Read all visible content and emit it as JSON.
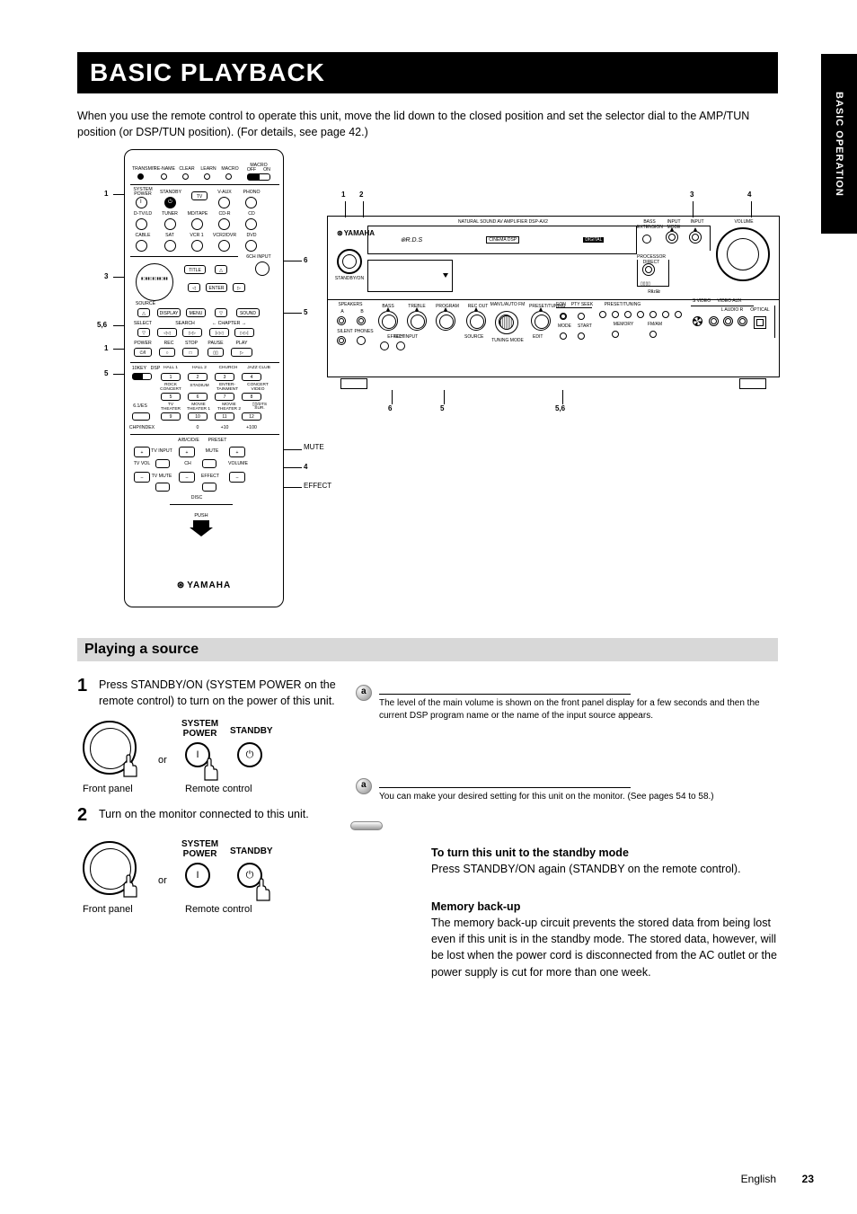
{
  "page": {
    "sidebar_tab": "BASIC OPERATION",
    "title": "BASIC PLAYBACK",
    "intro": "When you use the remote control to operate this unit, move the lid down to the closed position and set the selector dial to the AMP/TUN position (or DSP/TUN position). (For details, see page 42.)",
    "page_number": "23",
    "language": "English"
  },
  "remote": {
    "brand": "YAMAHA",
    "top_row": {
      "transmit": "TRANSMIT",
      "remame": "RE-NAME",
      "clear": "CLEAR",
      "learn": "LEARN",
      "macro": "MACRO",
      "macro_switch": [
        "OFF",
        "ON"
      ]
    },
    "row2": {
      "system_power": "SYSTEM POWER",
      "standby": "STANDBY",
      "tv": "TV",
      "vaux": "V-AUX",
      "phono": "PHONO"
    },
    "row3": {
      "dtvld": "D-TV/LD",
      "tuner": "TUNER",
      "mdtape": "MD/TAPE",
      "cdr": "CD-R",
      "cd": "CD"
    },
    "row4": {
      "cable": "CABLE",
      "sat": "SAT",
      "vcr1": "VCR 1",
      "vcr2dvr": "VCR2/DVR",
      "dvd": "DVD"
    },
    "sixch": "6CH INPUT",
    "dial_label": "",
    "nav": {
      "title": "TITLE",
      "enter": "ENTER",
      "chapter": "CHAPTER"
    },
    "source_row": {
      "source": "SOURCE",
      "display": "DISPLAY",
      "menu": "MENU",
      "sound": "SOUND"
    },
    "select_row": {
      "select": "SELECT",
      "search": "SEARCH"
    },
    "transport": {
      "power": "POWER",
      "rec": "REC",
      "stop": "STOP",
      "pause": "PAUSE",
      "play": "PLAY"
    },
    "tenkey": {
      "label": "10KEY",
      "dsp": "DSP"
    },
    "dsp_names": {
      "hall1": "HALL 1",
      "hall2": "HALL 2",
      "church": "CHURCH",
      "jazz": "JAZZ CLUB",
      "rock": "ROCK CONCERT",
      "stadium": "STADIUM",
      "enter": "ENTER-TAINMENT",
      "concert": "CONCERT VIDEO",
      "nums": [
        "1",
        "2",
        "3",
        "4",
        "5",
        "6",
        "7",
        "8",
        "9",
        "10",
        "11",
        "12"
      ],
      "movie": "MOVIE THEATER 1",
      "movie2": "MOVIE THEATER 2",
      "dts": "DOLBY/DTS SUR.",
      "slash": "/DTS",
      "zero": "0",
      "plus10": "+10",
      "plus100": "+100"
    },
    "bottom_bar": {
      "abcde": "A/B/C/D/E",
      "preset": "PRESET",
      "tvinput": "TV INPUT",
      "ch": "CH",
      "mute": "MUTE",
      "volume": "VOLUME",
      "tvvol": "TV VOL",
      "tvmute": "TV MUTE",
      "effect": "EFFECT",
      "disc": "DISC"
    },
    "push": "PUSH"
  },
  "callouts": {
    "top": "1",
    "sixch": "6",
    "dial": "3",
    "left_select": "5,6",
    "right_sound": "5",
    "left_tenkey": "5",
    "left_power": "1",
    "right_vol": "4",
    "right_mute": "MUTE",
    "right_effect": "EFFECT"
  },
  "unit": {
    "logo": "YAMAHA",
    "rds": "⊛R.D.S",
    "natural": "NATURAL SOUND AV AMPLIFIER DSP-AX2",
    "bass_ext": "BASS EXTENSION",
    "processor": "PROCESSOR DIRECT",
    "input_mode": "INPUT MODE",
    "input": "INPUT",
    "volume": "VOLUME",
    "standby": "STANDBY/ON",
    "speakers": "SPEAKERS",
    "a": "A",
    "b": "B",
    "silent": "SILENT",
    "phones": "PHONES",
    "bass": "BASS",
    "treble": "TREBLE",
    "effect": "EFFECT",
    "program": "PROGRAM",
    "sixch": "6CH INPUT",
    "recout": "REC OUT",
    "source": "SOURCE",
    "man": "MAN'L/AUTO FM",
    "eon": "EON",
    "ptyseek": "PTY SEEK",
    "mode": "MODE",
    "start": "START",
    "tuning": "TUNING MODE",
    "preset": "PRESET/TUNING",
    "edit": "EDIT",
    "memory": "MEMORY",
    "fmam": "FM/AM",
    "video": "S VIDEO",
    "vaux": "VIDEO AUX",
    "l": "L AUDIO R",
    "optical": "OPTICAL",
    "callout1": "1",
    "callout2": "2",
    "callout3": "3",
    "callout4": "4",
    "callout5": "5",
    "callout6": "6",
    "c56": "5,6"
  },
  "section": {
    "title": "Playing a source"
  },
  "step1": {
    "num": "1",
    "text": "Press STANDBY/ON (SYSTEM POWER on the remote control) to turn on the power of this unit.",
    "or": "or",
    "system_power": "SYSTEM\nPOWER",
    "standby": "STANDBY",
    "standby_icon": "⏻",
    "front_panel": "Front panel",
    "remote_control": "Remote control",
    "exp_a": "a",
    "exp_text": "The level of the main volume is shown on the front panel display for a few seconds and then the current DSP program name or the name of the input source appears."
  },
  "step2": {
    "num": "2",
    "text": "Turn on the monitor connected to this unit.",
    "system_power": "SYSTEM\nPOWER",
    "standby": "STANDBY",
    "standby_icon": "⏻",
    "front_panel": "Front panel",
    "remote_control": "Remote control",
    "or": "or",
    "exp_a": "a",
    "exp_text": "You can make your desired setting for this unit on the monitor. (See pages 54 to 58.)"
  },
  "desc": {
    "title": "To turn this unit to the standby mode",
    "body": "Press STANDBY/ON again (STANDBY on the remote control).",
    "memory_title": "Memory back-up",
    "memory_body": "The memory back-up circuit prevents the stored data from being lost even if this unit is in the standby mode. The stored data, however, will be lost when the power cord is disconnected from the AC outlet or the power supply is cut for more than one week."
  }
}
